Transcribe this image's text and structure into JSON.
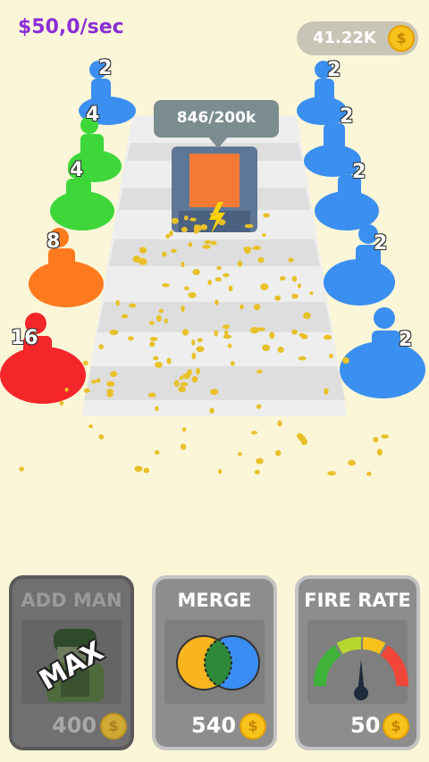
{
  "hud": {
    "income_rate": "$50,0/sec",
    "coin_total": "41.22K"
  },
  "boss": {
    "hp_text": "846/200k"
  },
  "units": {
    "left": [
      {
        "level": "2",
        "color": "#3b8ff0"
      },
      {
        "level": "4",
        "color": "#3ed73a"
      },
      {
        "level": "4",
        "color": "#3ed73a"
      },
      {
        "level": "8",
        "color": "#ff7a1e"
      },
      {
        "level": "16",
        "color": "#f4262a"
      }
    ],
    "right": [
      {
        "level": "2",
        "color": "#3b8ff0"
      },
      {
        "level": "2",
        "color": "#3b8ff0"
      },
      {
        "level": "2",
        "color": "#3b8ff0"
      },
      {
        "level": "2",
        "color": "#3b8ff0"
      },
      {
        "level": "2",
        "color": "#3b8ff0"
      }
    ]
  },
  "upgrades": {
    "add_man": {
      "title": "ADD MAN",
      "badge": "MAX",
      "cost": "400",
      "icon": "soldier-icon"
    },
    "merge": {
      "title": "MERGE",
      "cost": "540",
      "icon": "merge-circles-icon"
    },
    "fire_rate": {
      "title": "FIRE RATE",
      "cost": "50",
      "icon": "gauge-icon"
    }
  },
  "colors": {
    "accent": "#8a2fd6",
    "coin": "#f6c21b",
    "background": "#fbf6d8",
    "merge_left": "#f8b51f",
    "merge_right": "#3a8df2",
    "merge_overlap": "#2e8a3a"
  }
}
